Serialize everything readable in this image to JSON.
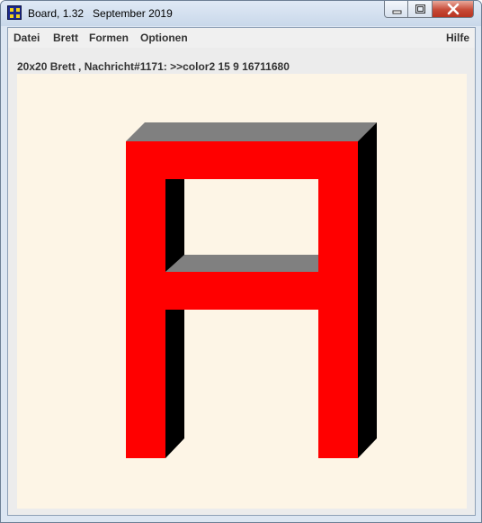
{
  "window": {
    "title": "Board, 1.32   September 2019"
  },
  "menu": {
    "items": [
      "Datei",
      "Brett",
      "Formen",
      "Optionen"
    ],
    "help": "Hilfe"
  },
  "status": {
    "text": "20x20 Brett , Nachricht#1171: >>color2 15 9 16711680"
  },
  "board": {
    "grid": "20x20",
    "shape": "A",
    "colors": {
      "background": "#fdf5e6",
      "front": "#ff0000",
      "top": "#808080",
      "side": "#000000"
    }
  }
}
